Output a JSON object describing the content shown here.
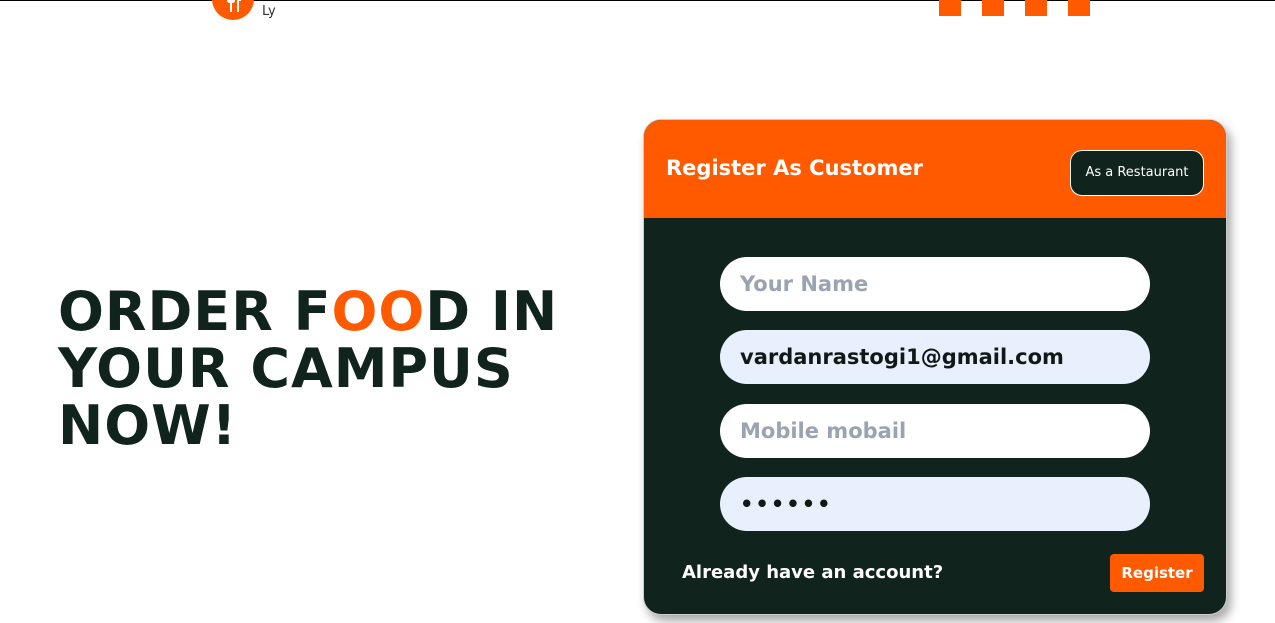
{
  "brand": {
    "logo_icon": "fork-knife-icon",
    "logo_text": "Ly",
    "accent_color": "#ff5a00",
    "dark_color": "#10231c"
  },
  "hero": {
    "line1_before": "ORDER F",
    "line1_accent": "OO",
    "line1_after": "D IN",
    "line2": "YOUR CAMPUS",
    "line3": "NOW!"
  },
  "form": {
    "title": "Register As Customer",
    "switch_label": "As a Restaurant",
    "fields": {
      "name": {
        "placeholder": "Your Name",
        "value": ""
      },
      "email": {
        "placeholder": "",
        "value": "vardanrastogi1@gmail.com"
      },
      "mobile": {
        "placeholder": "Mobile mobail",
        "value": ""
      },
      "password": {
        "placeholder": "",
        "value": "••••••"
      }
    },
    "login_prompt": "Already have an account?",
    "submit_label": "Register"
  }
}
